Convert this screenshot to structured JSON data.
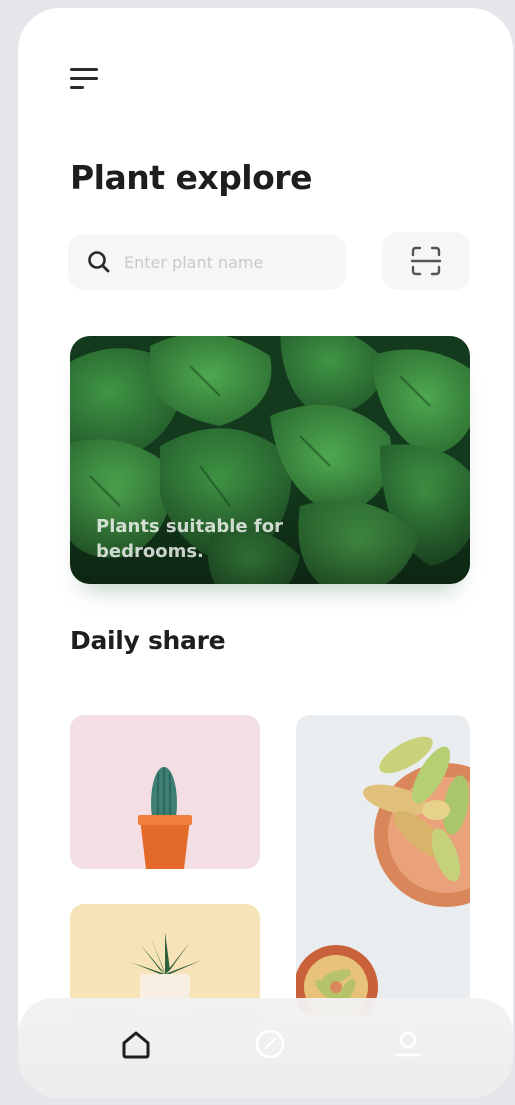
{
  "header": {
    "menu_icon": "hamburger-menu-icon",
    "title": "Plant explore"
  },
  "search": {
    "placeholder": "Enter plant name",
    "value": "",
    "icon": "search-icon",
    "scan_icon": "scan-icon"
  },
  "hero": {
    "caption": "Plants suitable for bedrooms."
  },
  "daily_share": {
    "title": "Daily share",
    "items": [
      {
        "subject": "cactus"
      },
      {
        "subject": "succulent"
      },
      {
        "subject": "aloe"
      }
    ]
  },
  "nav": {
    "items": [
      {
        "icon": "home-icon",
        "active": true
      },
      {
        "icon": "compass-icon",
        "active": false
      },
      {
        "icon": "profile-icon",
        "active": false
      }
    ]
  },
  "colors": {
    "background": "#ffffff",
    "text": "#1e1e1e",
    "leaf_green": "#2f7a3a",
    "nav_active": "#1e1e1e",
    "nav_inactive": "#ffffff"
  }
}
